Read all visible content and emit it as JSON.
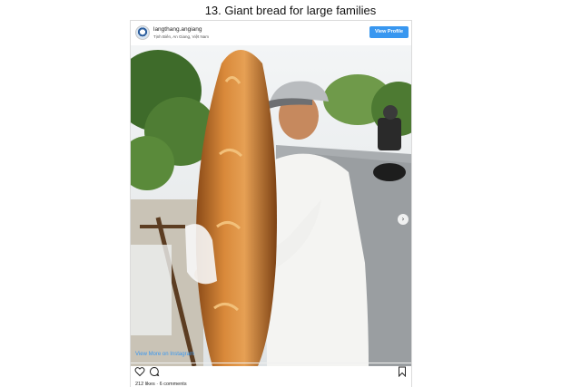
{
  "article": {
    "headline": "13. Giant bread for large families"
  },
  "post": {
    "username": "langthang.angiang",
    "location": "Tịnh Biên, An Giang, Việt Nam",
    "view_profile_label": "View Profile",
    "view_more_label": "View More on Instagram",
    "likes": "212 likes",
    "separator": "·",
    "comments": "6 comments",
    "next_icon": "chevron-right-icon",
    "action_icons": [
      "heart-icon",
      "comment-icon",
      "bookmark-icon"
    ]
  },
  "colors": {
    "accent": "#3897f0",
    "border": "#dbdbdb",
    "bread": "#c8782e"
  }
}
